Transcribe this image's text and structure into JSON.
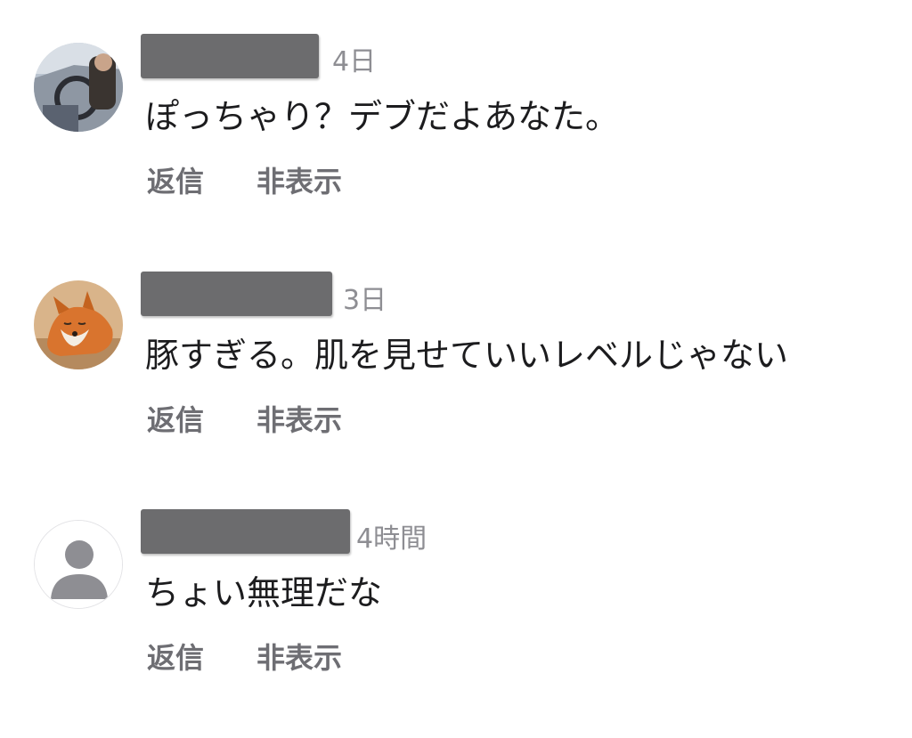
{
  "comments": [
    {
      "time": "4日",
      "text": "ぽっちゃり？デブだよあなた。",
      "reply_label": "返信",
      "hide_label": "非表示",
      "avatar_icon": "photo-avatar-car"
    },
    {
      "time": "3日",
      "text": "豚すぎる。肌を見せていいレベルじゃない",
      "reply_label": "返信",
      "hide_label": "非表示",
      "avatar_icon": "photo-avatar-fox"
    },
    {
      "time": "4時間",
      "text": "ちょい無理だな",
      "reply_label": "返信",
      "hide_label": "非表示",
      "avatar_icon": "default-user-icon"
    }
  ],
  "colors": {
    "text": "#1c1c1e",
    "meta": "#8e8e93",
    "action": "#6e6e73",
    "redaction": "#6c6c6e"
  }
}
